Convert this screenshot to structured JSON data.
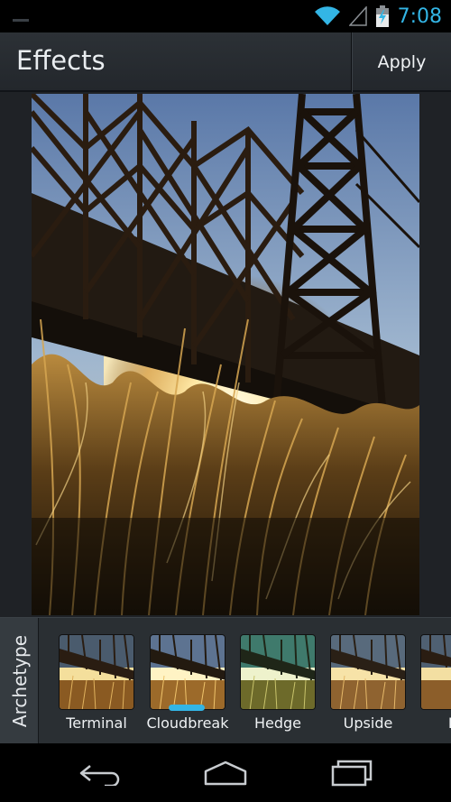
{
  "status_bar": {
    "time": "7:08",
    "icons": [
      "wifi-icon",
      "cell-signal-icon",
      "battery-charging-icon"
    ],
    "accent": "#33b5e5"
  },
  "action_bar": {
    "title": "Effects",
    "apply_label": "Apply"
  },
  "effects": {
    "category": "Archetype",
    "selected": "Cloudbreak",
    "items": [
      {
        "label": "Terminal"
      },
      {
        "label": "Cloudbreak"
      },
      {
        "label": "Hedge"
      },
      {
        "label": "Upside"
      },
      {
        "label": "Hu"
      }
    ],
    "indicator_color": "#33b5e5"
  },
  "nav_bar": {
    "buttons": [
      "back-icon",
      "home-icon",
      "recent-apps-icon"
    ]
  }
}
